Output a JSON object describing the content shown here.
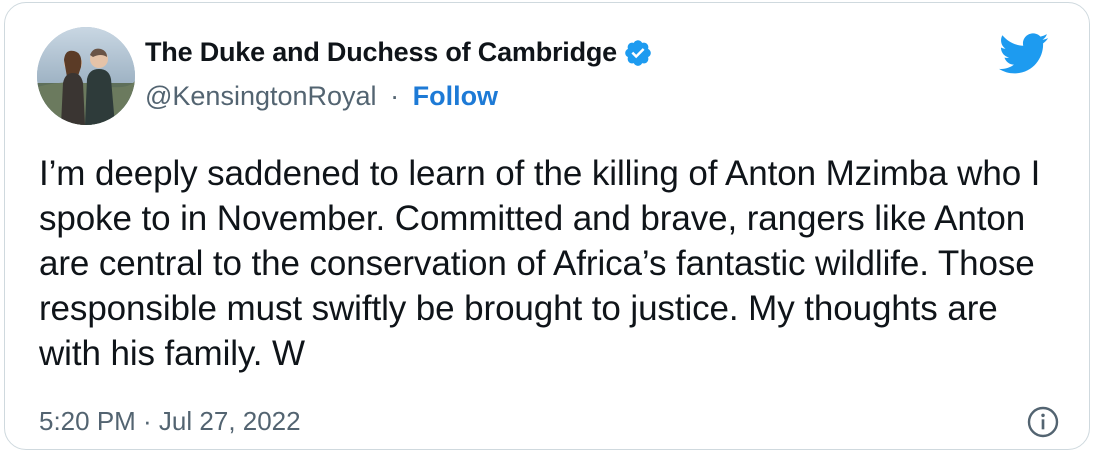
{
  "author": {
    "display_name": "The Duke and Duchess of Cambridge",
    "handle": "@KensingtonRoyal",
    "separator": "·",
    "follow_label": "Follow"
  },
  "tweet": {
    "text": "I’m deeply saddened to learn of the killing of Anton Mzimba who I spoke to in November. Committed and brave, rangers like Anton are central to the conservation of Africa’s fantastic wildlife. Those responsible must swiftly be brought to justice. My thoughts are with his family. W",
    "timestamp": "5:20 PM · Jul 27, 2022"
  },
  "icons": {
    "verified": "verified-badge-icon",
    "logo": "twitter-bird-icon",
    "info": "info-icon"
  },
  "colors": {
    "brand_blue": "#1d9bf0",
    "follow_blue": "#1d7ad6",
    "text_primary": "#0f1419",
    "text_secondary": "#536471"
  }
}
